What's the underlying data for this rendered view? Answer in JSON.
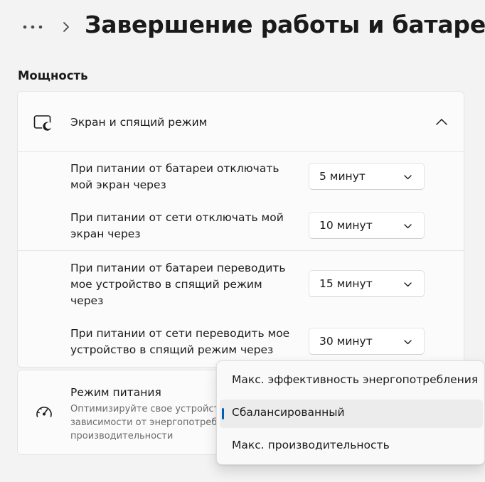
{
  "header": {
    "title": "Завершение работы и батарея"
  },
  "section": {
    "title": "Мощность"
  },
  "screen_sleep": {
    "label": "Экран и спящий режим",
    "rows": [
      {
        "label": "При питании от батареи отключать мой экран через",
        "value": "5 минут"
      },
      {
        "label": "При питании от сети отключать мой экран через",
        "value": "10 минут"
      },
      {
        "label": "При питании от батареи переводить мое устройство в спящий режим через",
        "value": "15 минут"
      },
      {
        "label": "При питании от сети переводить мое устройство в спящий режим через",
        "value": "30 минут"
      }
    ]
  },
  "power_mode": {
    "title": "Режим питания",
    "description_lines": [
      "Оптимизируйте свое устройство в",
      "зависимости от энергопотребления и",
      "производительности"
    ],
    "options": [
      {
        "label": "Макс. эффективность энергопотребления",
        "selected": false
      },
      {
        "label": "Сбалансированный",
        "selected": true
      },
      {
        "label": "Макс. производительность",
        "selected": false
      }
    ]
  },
  "icons": {
    "more": "more-dots-icon",
    "breadcrumb": "chevron-right-icon",
    "screen": "screen-sleep-icon",
    "collapse": "chevron-up-icon",
    "dropdown": "chevron-down-icon",
    "power": "speedometer-icon"
  },
  "colors": {
    "background": "#f3f3f3",
    "card": "#fbfbfb",
    "accent": "#005fb8",
    "secondary_text": "#6b6b6b"
  }
}
